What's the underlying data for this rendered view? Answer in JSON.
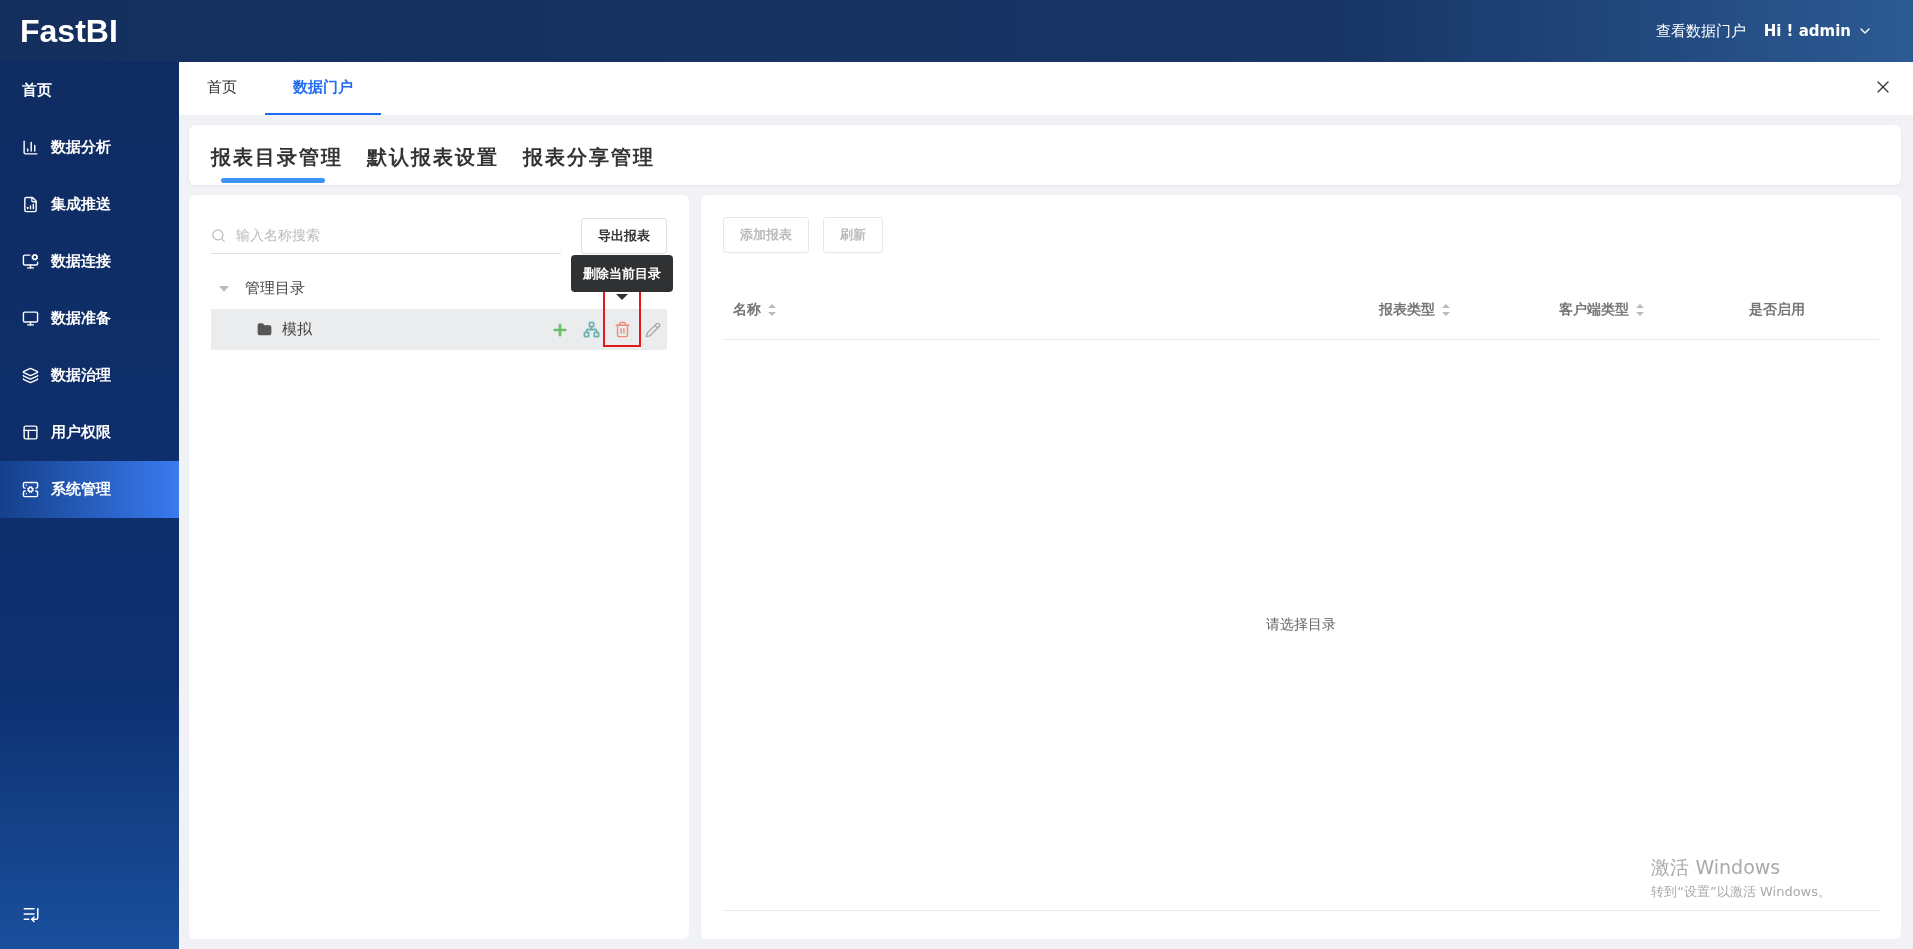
{
  "header": {
    "logo": "FastBI",
    "portal_link": "查看数据门户",
    "user_menu": "Hi ! admin"
  },
  "sidebar": {
    "items": [
      {
        "label": "首页",
        "selected": false
      },
      {
        "label": "数据分析",
        "selected": false
      },
      {
        "label": "集成推送",
        "selected": false
      },
      {
        "label": "数据连接",
        "selected": false
      },
      {
        "label": "数据准备",
        "selected": false
      },
      {
        "label": "数据治理",
        "selected": false
      },
      {
        "label": "用户权限",
        "selected": false
      },
      {
        "label": "系统管理",
        "selected": true
      }
    ]
  },
  "page_tabs": [
    {
      "label": "首页",
      "selected": false
    },
    {
      "label": "数据门户",
      "selected": true
    }
  ],
  "sub_tabs": [
    {
      "label": "报表目录管理",
      "selected": true
    },
    {
      "label": "默认报表设置",
      "selected": false
    },
    {
      "label": "报表分享管理",
      "selected": false
    }
  ],
  "left_panel": {
    "search": {
      "placeholder": "输入名称搜索"
    },
    "export_button": "导出报表",
    "tree": [
      {
        "label": "管理目录",
        "expanded": true,
        "children": [
          {
            "label": "模拟",
            "selected": true
          }
        ]
      }
    ],
    "tooltip": "删除当前目录"
  },
  "right_panel": {
    "buttons": [
      {
        "label": "添加报表",
        "disabled": true
      },
      {
        "label": "刷新",
        "disabled": true
      }
    ],
    "table": {
      "columns": [
        {
          "label": "名称",
          "sortable": true
        },
        {
          "label": "报表类型",
          "sortable": true
        },
        {
          "label": "客户端类型",
          "sortable": true
        },
        {
          "label": "是否启用",
          "sortable": false
        }
      ],
      "empty_text": "请选择目录"
    }
  },
  "os_notice": {
    "title": "激活 Windows",
    "subtitle": "转到“设置”以激活 Windows。"
  }
}
